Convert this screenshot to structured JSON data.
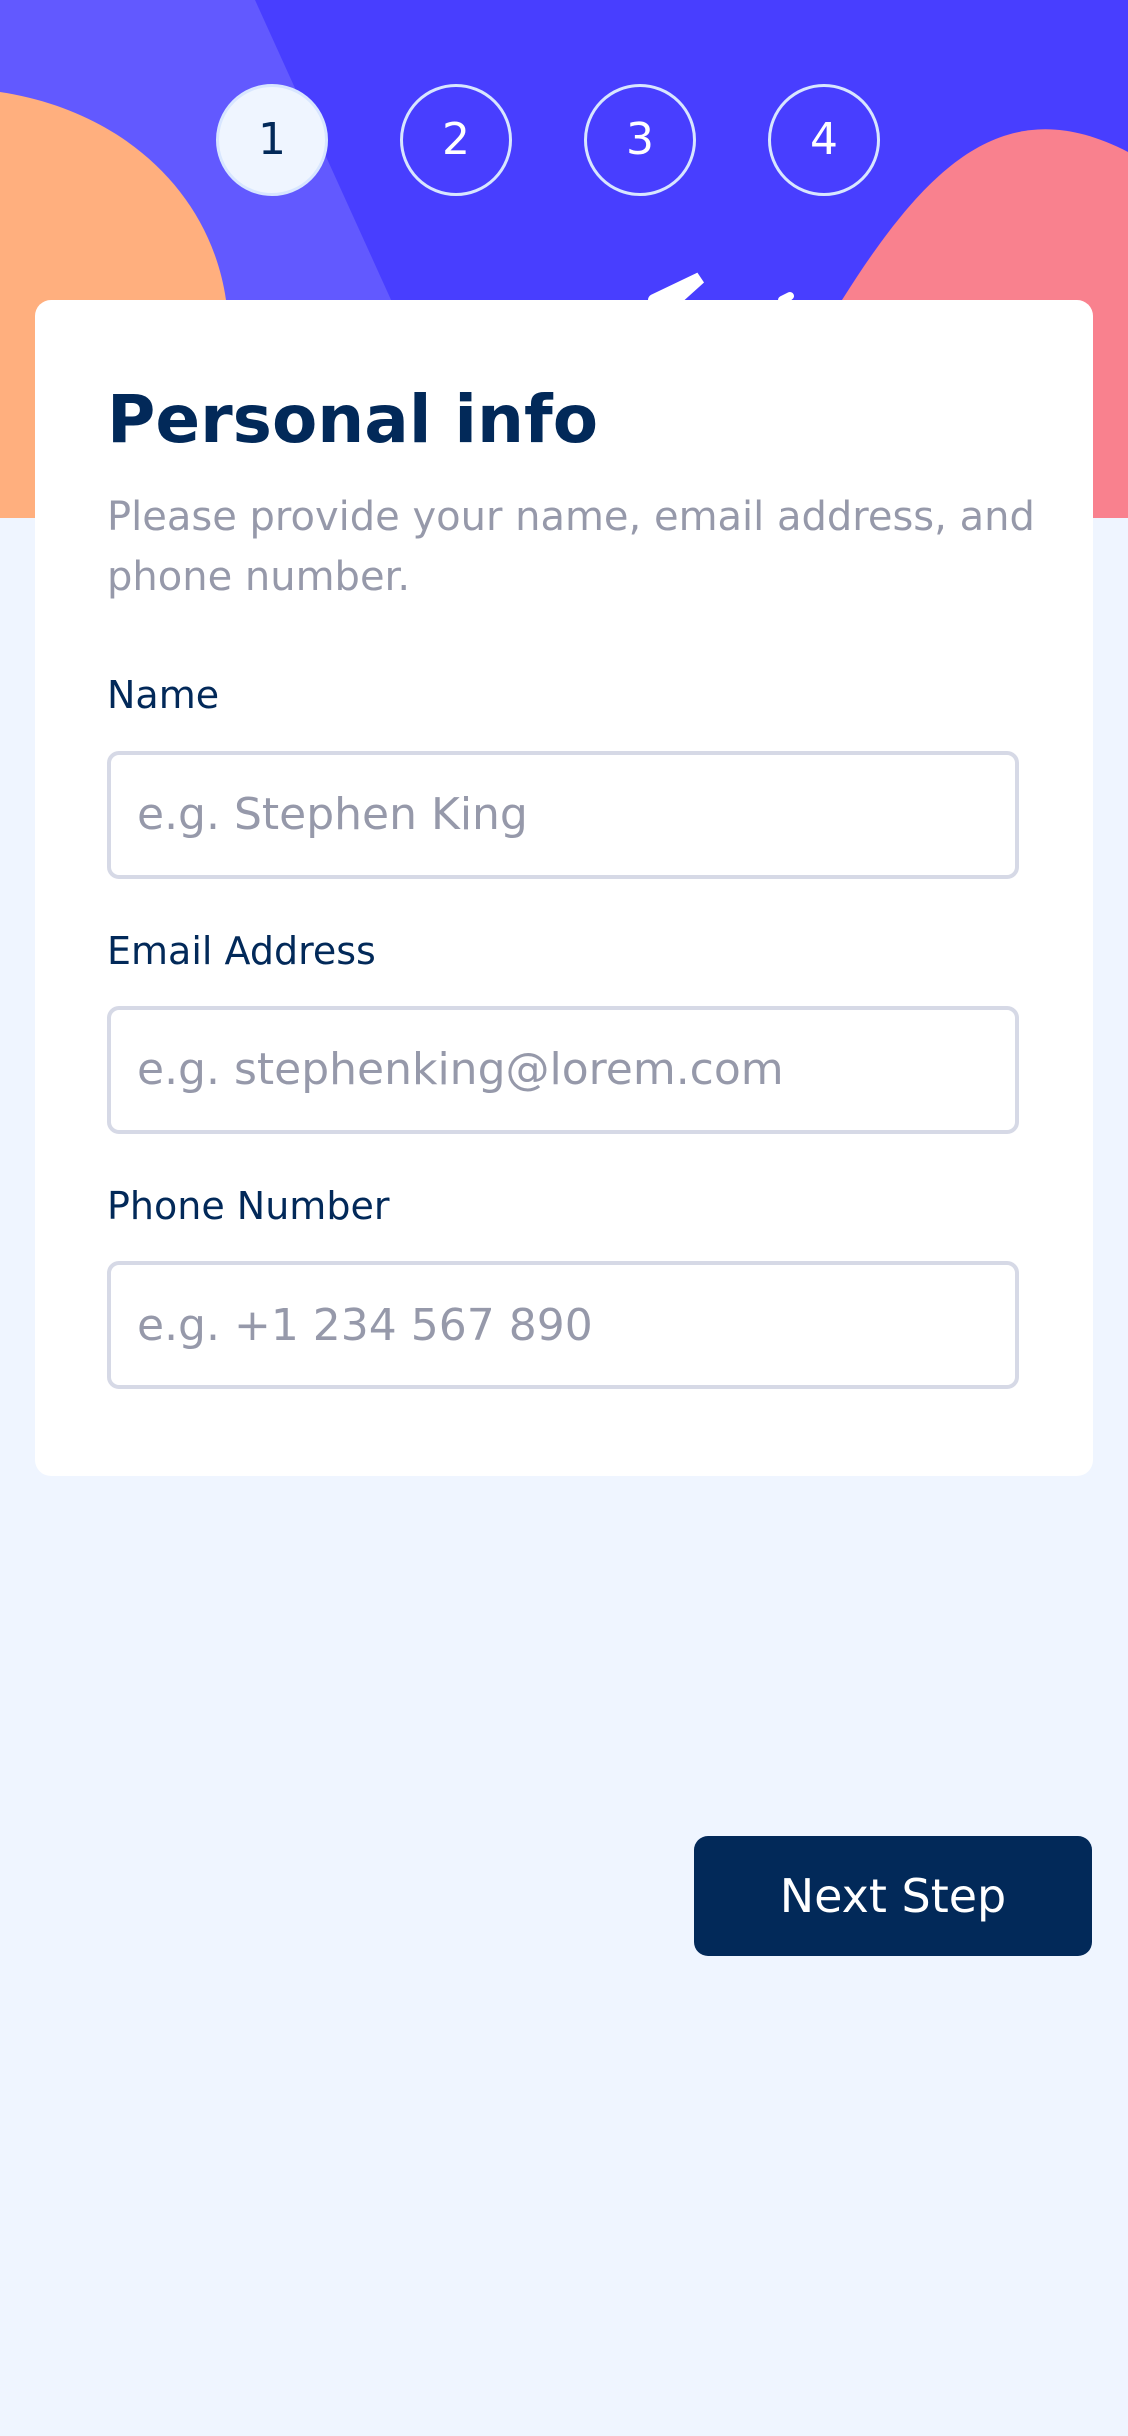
{
  "steps": [
    "1",
    "2",
    "3",
    "4"
  ],
  "active_step": 1,
  "form": {
    "title": "Personal info",
    "subtitle": "Please provide your name, email address, and phone number.",
    "fields": [
      {
        "label": "Name",
        "placeholder": "e.g. Stephen King",
        "value": ""
      },
      {
        "label": "Email Address",
        "placeholder": "e.g. stephenking@lorem.com",
        "value": ""
      },
      {
        "label": "Phone Number",
        "placeholder": "e.g. +1 234 567 890",
        "value": ""
      }
    ]
  },
  "actions": {
    "next_label": "Next Step"
  },
  "colors": {
    "primary": "#022959",
    "page_background": "#EFF5FF",
    "hero_purple": "#483EFF",
    "hero_light_purple": "#6259FF",
    "hero_orange": "#FFAF7E",
    "hero_pink": "#F9818E",
    "muted_text": "#9699AA",
    "border": "#D6D9E6"
  }
}
